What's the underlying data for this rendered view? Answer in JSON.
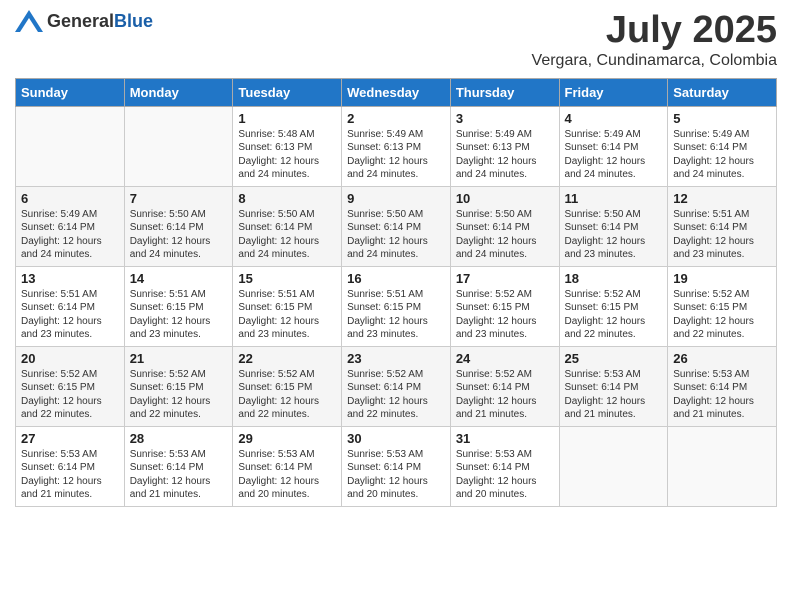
{
  "logo": {
    "general": "General",
    "blue": "Blue"
  },
  "header": {
    "month": "July 2025",
    "location": "Vergara, Cundinamarca, Colombia"
  },
  "weekdays": [
    "Sunday",
    "Monday",
    "Tuesday",
    "Wednesday",
    "Thursday",
    "Friday",
    "Saturday"
  ],
  "weeks": [
    [
      {
        "day": "",
        "info": ""
      },
      {
        "day": "",
        "info": ""
      },
      {
        "day": "1",
        "info": "Sunrise: 5:48 AM\nSunset: 6:13 PM\nDaylight: 12 hours and 24 minutes."
      },
      {
        "day": "2",
        "info": "Sunrise: 5:49 AM\nSunset: 6:13 PM\nDaylight: 12 hours and 24 minutes."
      },
      {
        "day": "3",
        "info": "Sunrise: 5:49 AM\nSunset: 6:13 PM\nDaylight: 12 hours and 24 minutes."
      },
      {
        "day": "4",
        "info": "Sunrise: 5:49 AM\nSunset: 6:14 PM\nDaylight: 12 hours and 24 minutes."
      },
      {
        "day": "5",
        "info": "Sunrise: 5:49 AM\nSunset: 6:14 PM\nDaylight: 12 hours and 24 minutes."
      }
    ],
    [
      {
        "day": "6",
        "info": "Sunrise: 5:49 AM\nSunset: 6:14 PM\nDaylight: 12 hours and 24 minutes."
      },
      {
        "day": "7",
        "info": "Sunrise: 5:50 AM\nSunset: 6:14 PM\nDaylight: 12 hours and 24 minutes."
      },
      {
        "day": "8",
        "info": "Sunrise: 5:50 AM\nSunset: 6:14 PM\nDaylight: 12 hours and 24 minutes."
      },
      {
        "day": "9",
        "info": "Sunrise: 5:50 AM\nSunset: 6:14 PM\nDaylight: 12 hours and 24 minutes."
      },
      {
        "day": "10",
        "info": "Sunrise: 5:50 AM\nSunset: 6:14 PM\nDaylight: 12 hours and 24 minutes."
      },
      {
        "day": "11",
        "info": "Sunrise: 5:50 AM\nSunset: 6:14 PM\nDaylight: 12 hours and 23 minutes."
      },
      {
        "day": "12",
        "info": "Sunrise: 5:51 AM\nSunset: 6:14 PM\nDaylight: 12 hours and 23 minutes."
      }
    ],
    [
      {
        "day": "13",
        "info": "Sunrise: 5:51 AM\nSunset: 6:14 PM\nDaylight: 12 hours and 23 minutes."
      },
      {
        "day": "14",
        "info": "Sunrise: 5:51 AM\nSunset: 6:15 PM\nDaylight: 12 hours and 23 minutes."
      },
      {
        "day": "15",
        "info": "Sunrise: 5:51 AM\nSunset: 6:15 PM\nDaylight: 12 hours and 23 minutes."
      },
      {
        "day": "16",
        "info": "Sunrise: 5:51 AM\nSunset: 6:15 PM\nDaylight: 12 hours and 23 minutes."
      },
      {
        "day": "17",
        "info": "Sunrise: 5:52 AM\nSunset: 6:15 PM\nDaylight: 12 hours and 23 minutes."
      },
      {
        "day": "18",
        "info": "Sunrise: 5:52 AM\nSunset: 6:15 PM\nDaylight: 12 hours and 22 minutes."
      },
      {
        "day": "19",
        "info": "Sunrise: 5:52 AM\nSunset: 6:15 PM\nDaylight: 12 hours and 22 minutes."
      }
    ],
    [
      {
        "day": "20",
        "info": "Sunrise: 5:52 AM\nSunset: 6:15 PM\nDaylight: 12 hours and 22 minutes."
      },
      {
        "day": "21",
        "info": "Sunrise: 5:52 AM\nSunset: 6:15 PM\nDaylight: 12 hours and 22 minutes."
      },
      {
        "day": "22",
        "info": "Sunrise: 5:52 AM\nSunset: 6:15 PM\nDaylight: 12 hours and 22 minutes."
      },
      {
        "day": "23",
        "info": "Sunrise: 5:52 AM\nSunset: 6:14 PM\nDaylight: 12 hours and 22 minutes."
      },
      {
        "day": "24",
        "info": "Sunrise: 5:52 AM\nSunset: 6:14 PM\nDaylight: 12 hours and 21 minutes."
      },
      {
        "day": "25",
        "info": "Sunrise: 5:53 AM\nSunset: 6:14 PM\nDaylight: 12 hours and 21 minutes."
      },
      {
        "day": "26",
        "info": "Sunrise: 5:53 AM\nSunset: 6:14 PM\nDaylight: 12 hours and 21 minutes."
      }
    ],
    [
      {
        "day": "27",
        "info": "Sunrise: 5:53 AM\nSunset: 6:14 PM\nDaylight: 12 hours and 21 minutes."
      },
      {
        "day": "28",
        "info": "Sunrise: 5:53 AM\nSunset: 6:14 PM\nDaylight: 12 hours and 21 minutes."
      },
      {
        "day": "29",
        "info": "Sunrise: 5:53 AM\nSunset: 6:14 PM\nDaylight: 12 hours and 20 minutes."
      },
      {
        "day": "30",
        "info": "Sunrise: 5:53 AM\nSunset: 6:14 PM\nDaylight: 12 hours and 20 minutes."
      },
      {
        "day": "31",
        "info": "Sunrise: 5:53 AM\nSunset: 6:14 PM\nDaylight: 12 hours and 20 minutes."
      },
      {
        "day": "",
        "info": ""
      },
      {
        "day": "",
        "info": ""
      }
    ]
  ]
}
